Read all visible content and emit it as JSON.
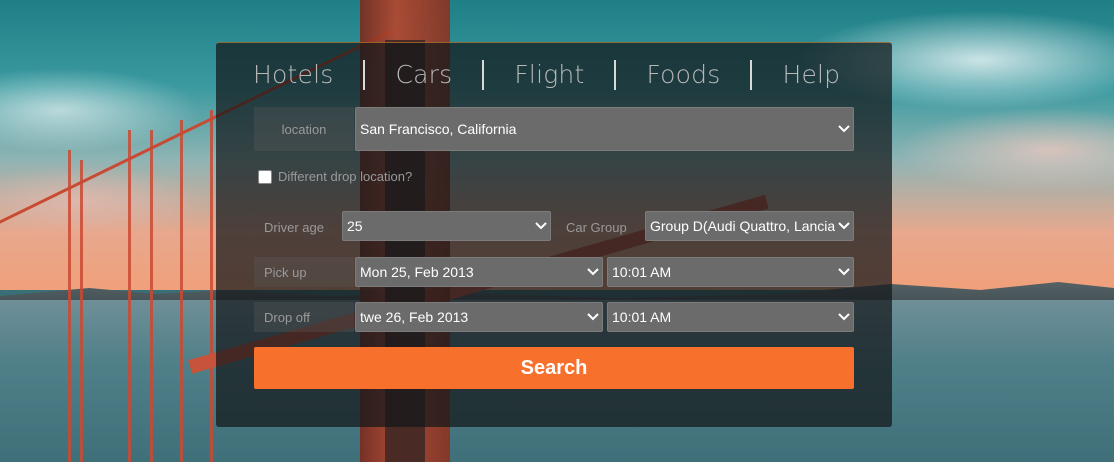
{
  "nav": {
    "items": [
      "Hotels",
      "Cars",
      "Flight",
      "Foods",
      "Help"
    ]
  },
  "form": {
    "location_label": "location",
    "location_value": "San Francisco, California",
    "drop_checkbox_label": "Different drop location?",
    "drop_checkbox_checked": false,
    "driver_age_label": "Driver age",
    "driver_age_value": "25",
    "car_group_label": "Car Group",
    "car_group_value": "Group D(Audi Quattro, Lancia D",
    "pickup_label": "Pick up",
    "pickup_date": "Mon 25, Feb 2013",
    "pickup_time": "10:01 AM",
    "dropoff_label": "Drop off",
    "dropoff_date": "twe 26, Feb 2013",
    "dropoff_time": "10:01 AM",
    "search_label": "Search"
  },
  "colors": {
    "accent": "#f8712c",
    "panel": "#14181a"
  },
  "icons": {
    "dropdown": "chevron-down-icon"
  }
}
